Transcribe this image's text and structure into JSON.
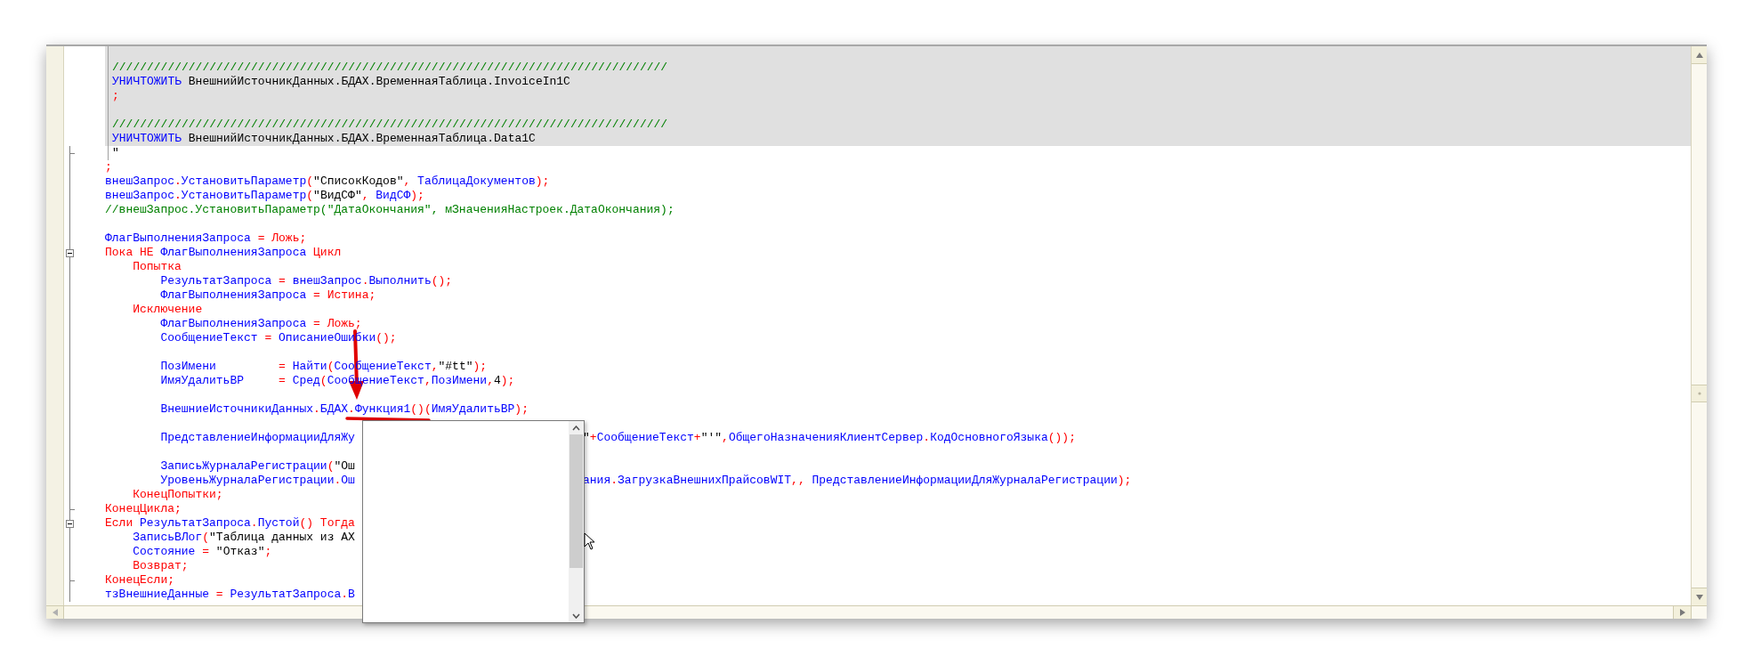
{
  "lines": [
    {
      "kind": "query",
      "highlighted": true
    },
    {
      "kind": "query",
      "highlighted": true,
      "segments": [
        {
          "kind": "comment",
          "text": "////////////////////////////////////////////////////////////////////////////////"
        }
      ]
    },
    {
      "kind": "query",
      "highlighted": true,
      "segments": [
        {
          "kind": "name",
          "text": "УНИЧТОЖИТЬ"
        },
        {
          "kind": "string",
          "text": " ВнешнийИсточникДанных.БДАХ.ВременнаяТаблица.InvoiceIn1C"
        }
      ]
    },
    {
      "kind": "query",
      "highlighted": true,
      "segments": [
        {
          "kind": "keyword",
          "text": ";"
        }
      ]
    },
    {
      "kind": "query",
      "highlighted": true
    },
    {
      "kind": "query",
      "highlighted": true,
      "segments": [
        {
          "kind": "comment",
          "text": "////////////////////////////////////////////////////////////////////////////////"
        }
      ]
    },
    {
      "kind": "query",
      "highlighted": true,
      "segments": [
        {
          "kind": "name",
          "text": "УНИЧТОЖИТЬ"
        },
        {
          "kind": "string",
          "text": " ВнешнийИсточникДанных.БДАХ.ВременнаяТаблица.Data1C"
        }
      ]
    },
    {
      "kind": "queryend",
      "highlighted": false,
      "segments": [
        {
          "kind": "string",
          "text": "\""
        }
      ]
    },
    {
      "kind": "code",
      "segments": [
        {
          "kind": "keyword",
          "text": ";"
        }
      ]
    },
    {
      "kind": "code",
      "segments": [
        {
          "kind": "name",
          "text": "внешЗапрос"
        },
        {
          "kind": "keyword",
          "text": "."
        },
        {
          "kind": "name",
          "text": "УстановитьПараметр"
        },
        {
          "kind": "keyword",
          "text": "("
        },
        {
          "kind": "string",
          "text": "\"СписокКодов\""
        },
        {
          "kind": "keyword",
          "text": ", "
        },
        {
          "kind": "name",
          "text": "ТаблицаДокументов"
        },
        {
          "kind": "keyword",
          "text": ");"
        }
      ]
    },
    {
      "kind": "code",
      "segments": [
        {
          "kind": "name",
          "text": "внешЗапрос"
        },
        {
          "kind": "keyword",
          "text": "."
        },
        {
          "kind": "name",
          "text": "УстановитьПараметр"
        },
        {
          "kind": "keyword",
          "text": "("
        },
        {
          "kind": "string",
          "text": "\"ВидСФ\""
        },
        {
          "kind": "keyword",
          "text": ", "
        },
        {
          "kind": "name",
          "text": "ВидСФ"
        },
        {
          "kind": "keyword",
          "text": ");"
        }
      ]
    },
    {
      "kind": "code",
      "segments": [
        {
          "kind": "comment",
          "text": "//внешЗапрос.УстановитьПараметр(\"ДатаОкончания\", мЗначенияНастроек.ДатаОкончания);"
        }
      ]
    },
    {
      "kind": "code"
    },
    {
      "kind": "code",
      "segments": [
        {
          "kind": "name",
          "text": "ФлагВыполненияЗапроса"
        },
        {
          "kind": "keyword",
          "text": " = Ложь;"
        }
      ]
    },
    {
      "kind": "open",
      "segments": [
        {
          "kind": "keyword",
          "text": "Пока НЕ "
        },
        {
          "kind": "name",
          "text": "ФлагВыполненияЗапроса"
        },
        {
          "kind": "keyword",
          "text": " Цикл"
        }
      ]
    },
    {
      "kind": "code",
      "segments": [
        {
          "kind": "keyword",
          "text": "    Попытка"
        }
      ]
    },
    {
      "kind": "code",
      "segments": [
        {
          "kind": "name",
          "text": "        РезультатЗапроса"
        },
        {
          "kind": "keyword",
          "text": " = "
        },
        {
          "kind": "name",
          "text": "внешЗапрос"
        },
        {
          "kind": "keyword",
          "text": "."
        },
        {
          "kind": "name",
          "text": "Выполнить"
        },
        {
          "kind": "keyword",
          "text": "();"
        }
      ]
    },
    {
      "kind": "code",
      "segments": [
        {
          "kind": "name",
          "text": "        ФлагВыполненияЗапроса"
        },
        {
          "kind": "keyword",
          "text": " = Истина;"
        }
      ]
    },
    {
      "kind": "code",
      "segments": [
        {
          "kind": "keyword",
          "text": "    Исключение"
        }
      ]
    },
    {
      "kind": "code",
      "segments": [
        {
          "kind": "name",
          "text": "        ФлагВыполненияЗапроса"
        },
        {
          "kind": "keyword",
          "text": " = Ложь;"
        }
      ]
    },
    {
      "kind": "code",
      "segments": [
        {
          "kind": "name",
          "text": "        СообщениеТекст"
        },
        {
          "kind": "keyword",
          "text": " = "
        },
        {
          "kind": "name",
          "text": "ОписаниеОшибки"
        },
        {
          "kind": "keyword",
          "text": "();"
        }
      ]
    },
    {
      "kind": "code"
    },
    {
      "kind": "code",
      "segments": [
        {
          "kind": "name",
          "text": "        ПозИмени"
        },
        {
          "kind": "keyword",
          "text": "         = "
        },
        {
          "kind": "name",
          "text": "Найти"
        },
        {
          "kind": "keyword",
          "text": "("
        },
        {
          "kind": "name",
          "text": "СообщениеТекст"
        },
        {
          "kind": "keyword",
          "text": ","
        },
        {
          "kind": "string",
          "text": "\"#tt\""
        },
        {
          "kind": "keyword",
          "text": ");"
        }
      ]
    },
    {
      "kind": "code",
      "segments": [
        {
          "kind": "name",
          "text": "        ИмяУдалитьВР"
        },
        {
          "kind": "keyword",
          "text": "     = "
        },
        {
          "kind": "name",
          "text": "Сред"
        },
        {
          "kind": "keyword",
          "text": "("
        },
        {
          "kind": "name",
          "text": "СообщениеТекст"
        },
        {
          "kind": "keyword",
          "text": ","
        },
        {
          "kind": "name",
          "text": "ПозИмени"
        },
        {
          "kind": "keyword",
          "text": ","
        },
        {
          "kind": "string",
          "text": "4"
        },
        {
          "kind": "keyword",
          "text": ");"
        }
      ]
    },
    {
      "kind": "code"
    },
    {
      "kind": "code",
      "segments": [
        {
          "kind": "name",
          "text": "        ВнешниеИсточникиДанных"
        },
        {
          "kind": "keyword",
          "text": "."
        },
        {
          "kind": "name",
          "text": "БДАХ"
        },
        {
          "kind": "keyword",
          "text": "."
        },
        {
          "kind": "name",
          "text": "Функция1"
        },
        {
          "kind": "keyword",
          "text": "()("
        },
        {
          "kind": "name",
          "text": "ИмяУдалитьВР"
        },
        {
          "kind": "keyword",
          "text": ");"
        }
      ]
    },
    {
      "kind": "code"
    },
    {
      "kind": "code",
      "segments": [
        {
          "kind": "name",
          "text": "        ПредставлениеИнформацииДляЖу"
        }
      ],
      "after_popup": [
        {
          "kind": "string",
          "text": "\""
        },
        {
          "kind": "keyword",
          "text": "+"
        },
        {
          "kind": "name",
          "text": "СообщениеТекст"
        },
        {
          "kind": "keyword",
          "text": "+"
        },
        {
          "kind": "string",
          "text": "\"'\""
        },
        {
          "kind": "keyword",
          "text": ","
        },
        {
          "kind": "name",
          "text": "ОбщегоНазначенияКлиентСервер"
        },
        {
          "kind": "keyword",
          "text": "."
        },
        {
          "kind": "name",
          "text": "КодОсновногоЯзыка"
        },
        {
          "kind": "keyword",
          "text": "());"
        }
      ]
    },
    {
      "kind": "code"
    },
    {
      "kind": "code",
      "segments": [
        {
          "kind": "name",
          "text": "        ЗаписьЖурналаРегистрации"
        },
        {
          "kind": "keyword",
          "text": "("
        },
        {
          "kind": "string",
          "text": "\"Ош"
        }
      ]
    },
    {
      "kind": "code",
      "segments": [
        {
          "kind": "name",
          "text": "        УровеньЖурналаРегистрации"
        },
        {
          "kind": "keyword",
          "text": "."
        },
        {
          "kind": "name",
          "text": "Ош"
        }
      ],
      "after_popup": [
        {
          "kind": "name",
          "text": "ания"
        },
        {
          "kind": "keyword",
          "text": "."
        },
        {
          "kind": "name",
          "text": "ЗагрузкаВнешнихПрайсовWIT"
        },
        {
          "kind": "keyword",
          "text": ",, "
        },
        {
          "kind": "name",
          "text": "ПредставлениеИнформацииДляЖурналаРегистрации"
        },
        {
          "kind": "keyword",
          "text": ");"
        }
      ]
    },
    {
      "kind": "code",
      "segments": [
        {
          "kind": "keyword",
          "text": "    КонецПопытки;"
        }
      ]
    },
    {
      "kind": "close",
      "segments": [
        {
          "kind": "keyword",
          "text": "КонецЦикла;"
        }
      ]
    },
    {
      "kind": "open",
      "segments": [
        {
          "kind": "keyword",
          "text": "Если "
        },
        {
          "kind": "name",
          "text": "РезультатЗапроса"
        },
        {
          "kind": "keyword",
          "text": "."
        },
        {
          "kind": "name",
          "text": "Пустой"
        },
        {
          "kind": "keyword",
          "text": "() Тогда"
        }
      ]
    },
    {
      "kind": "code",
      "segments": [
        {
          "kind": "name",
          "text": "    ЗаписьВЛог"
        },
        {
          "kind": "keyword",
          "text": "("
        },
        {
          "kind": "string",
          "text": "\"Таблица данных из АХ"
        }
      ]
    },
    {
      "kind": "code",
      "segments": [
        {
          "kind": "name",
          "text": "    Состояние"
        },
        {
          "kind": "keyword",
          "text": " = "
        },
        {
          "kind": "string",
          "text": "\"Отказ\""
        },
        {
          "kind": "keyword",
          "text": ";"
        }
      ]
    },
    {
      "kind": "code",
      "segments": [
        {
          "kind": "keyword",
          "text": "    Возврат;"
        }
      ]
    },
    {
      "kind": "close",
      "segments": [
        {
          "kind": "keyword",
          "text": "КонецЕсли;"
        }
      ]
    },
    {
      "kind": "code",
      "segments": [
        {
          "kind": "name",
          "text": "тзВнешниеДанные"
        },
        {
          "kind": "keyword",
          "text": " = "
        },
        {
          "kind": "name",
          "text": "РезультатЗапроса"
        },
        {
          "kind": "keyword",
          "text": "."
        },
        {
          "kind": "name",
          "text": "В"
        }
      ]
    }
  ]
}
